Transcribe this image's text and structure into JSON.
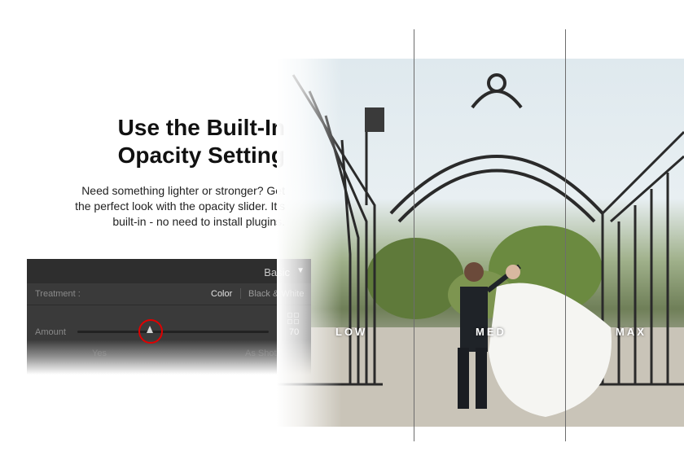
{
  "headline": {
    "line1": "Use the Built-In",
    "line2": "Opacity Setting"
  },
  "subtext": {
    "line1": "Need something lighter or stronger? Get",
    "line2": "the perfect look with the opacity slider. It's",
    "line3": "built-in - no need to install plugins."
  },
  "panel": {
    "title": "Basic",
    "treatment_label": "Treatment :",
    "treatment_color": "Color",
    "treatment_bw": "Black & White",
    "amount_label": "Amount",
    "amount_value": "70",
    "amount_fraction": 0.38,
    "faded_left": "Yes",
    "faded_right": "As Shot"
  },
  "zones": {
    "low": "LOW",
    "med": "MED",
    "max": "MAX"
  },
  "colors": {
    "highlight_ring": "#e00000",
    "panel_bg": "#3a3a3a",
    "panel_header": "#2e2e2e"
  },
  "icons": {
    "collapse": "triangle-down-icon",
    "grid": "grid-icon"
  }
}
